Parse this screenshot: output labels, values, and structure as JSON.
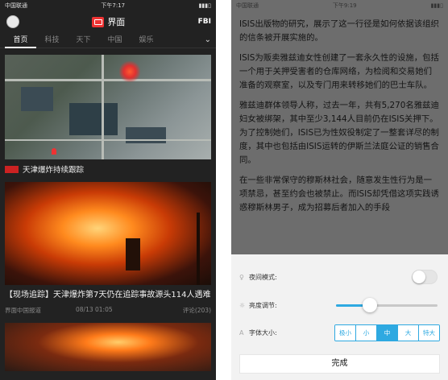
{
  "left": {
    "status": {
      "carrier": "中国联通",
      "time": "下午7:17",
      "battery": ""
    },
    "header": {
      "brand": "界面",
      "fbi": "FBI"
    },
    "tabs": [
      "首页",
      "科技",
      "天下",
      "中国",
      "娱乐"
    ],
    "active_tab": 0,
    "feed": {
      "item1_caption": "天津爆炸持续跟踪",
      "item2_headline": "【现场追踪】天津爆炸第7天仍在追踪事故源头114人遇难",
      "item2_source": "界面中国报道",
      "item2_time": "08/13 01:05",
      "item2_comments": "评论(203)"
    }
  },
  "right": {
    "status": {
      "carrier": "中国联通",
      "time": "下午9:19",
      "battery": ""
    },
    "article": [
      "ISIS出版物的研究，展示了这一行径是如何依据该组织的信条被开展实施的。",
      "ISIS为贩卖雅兹迪女性创建了一套永久性的设施，包括一个用于关押受害者的仓库网络，为检阅和交易她们准备的观察室，以及专门用来转移她们的巴士车队。",
      "雅兹迪群体领导人称，过去一年，共有5,270名雅兹迪妇女被绑架，其中至少3,144人目前仍在ISIS关押下。为了控制她们，ISIS已为性奴役制定了一整套详尽的制度，其中也包括由ISIS运转的伊斯兰法庭公证的销售合同。",
      "在一些非常保守的穆斯林社会，随意发生性行为是一项禁忌，甚至约会也被禁止。而ISIS却凭借这项实践诱惑穆斯林男子，成为招募后者加入的手段"
    ],
    "settings": {
      "night_mode_label": "夜间模式:",
      "night_mode_on": false,
      "brightness_label": "亮度调节:",
      "brightness": 0.33,
      "font_size_label": "字体大小:",
      "font_sizes": [
        "极小",
        "小",
        "中",
        "大",
        "特大"
      ],
      "font_size_selected": 2,
      "done_label": "完成"
    }
  }
}
